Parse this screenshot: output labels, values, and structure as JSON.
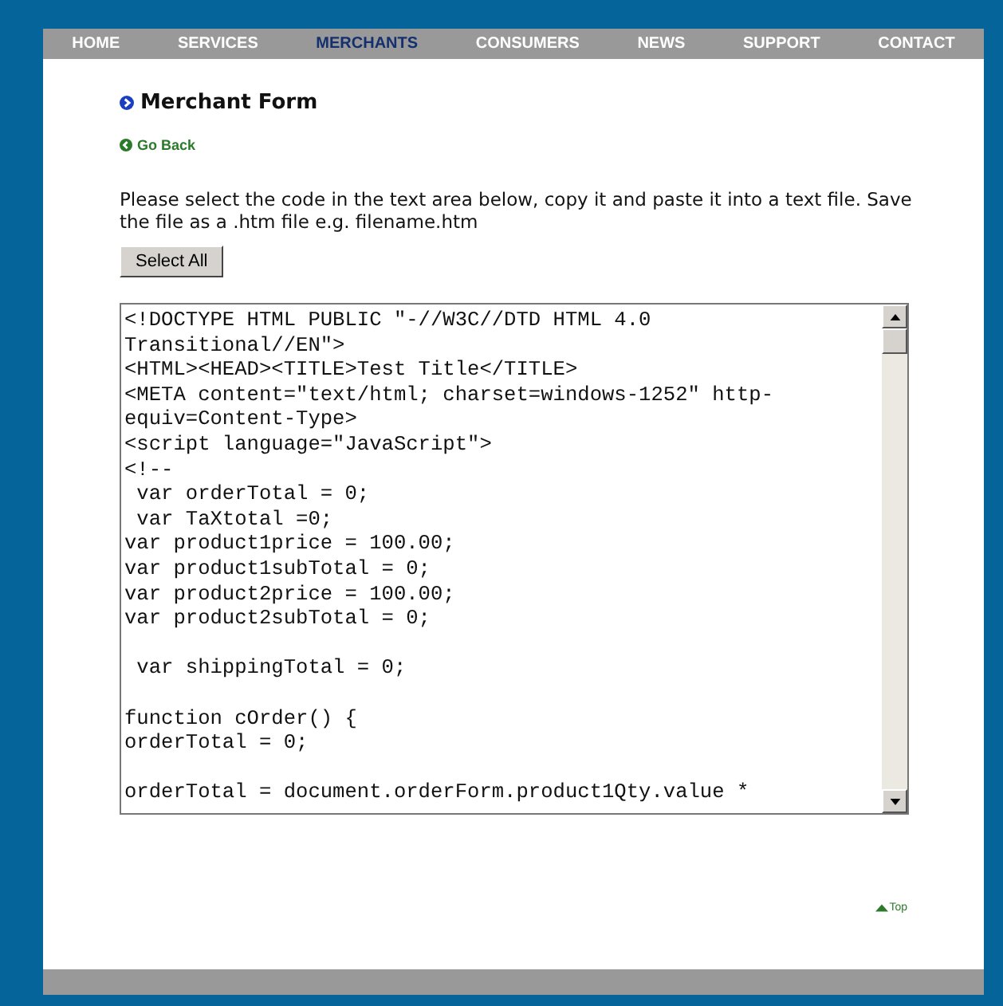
{
  "nav": [
    {
      "label": "HOME",
      "selected": false
    },
    {
      "label": "SERVICES",
      "selected": false
    },
    {
      "label": "MERCHANTS",
      "selected": true
    },
    {
      "label": "CONSUMERS",
      "selected": false
    },
    {
      "label": "NEWS",
      "selected": false
    },
    {
      "label": "SUPPORT",
      "selected": false
    },
    {
      "label": "CONTACT",
      "selected": false
    }
  ],
  "title": "Merchant Form",
  "back_link": "Go Back",
  "instructions": "Please select the code in the text area below, copy it and paste it into a text file. Save the file as a .htm file e.g. filename.htm",
  "select_all_button": "Select All",
  "code": "<!DOCTYPE HTML PUBLIC \"-//W3C//DTD HTML 4.0\nTransitional//EN\">\n<HTML><HEAD><TITLE>Test Title</TITLE>\n<META content=\"text/html; charset=windows-1252\" http-\nequiv=Content-Type>\n<script language=\"JavaScript\">\n<!--\n var orderTotal = 0;\n var TaXtotal =0;\nvar product1price = 100.00;\nvar product1subTotal = 0;\nvar product2price = 100.00;\nvar product2subTotal = 0;\n\n var shippingTotal = 0;\n\nfunction cOrder() {\norderTotal = 0;\n\norderTotal = document.orderForm.product1Qty.value *",
  "top_link": "Top"
}
